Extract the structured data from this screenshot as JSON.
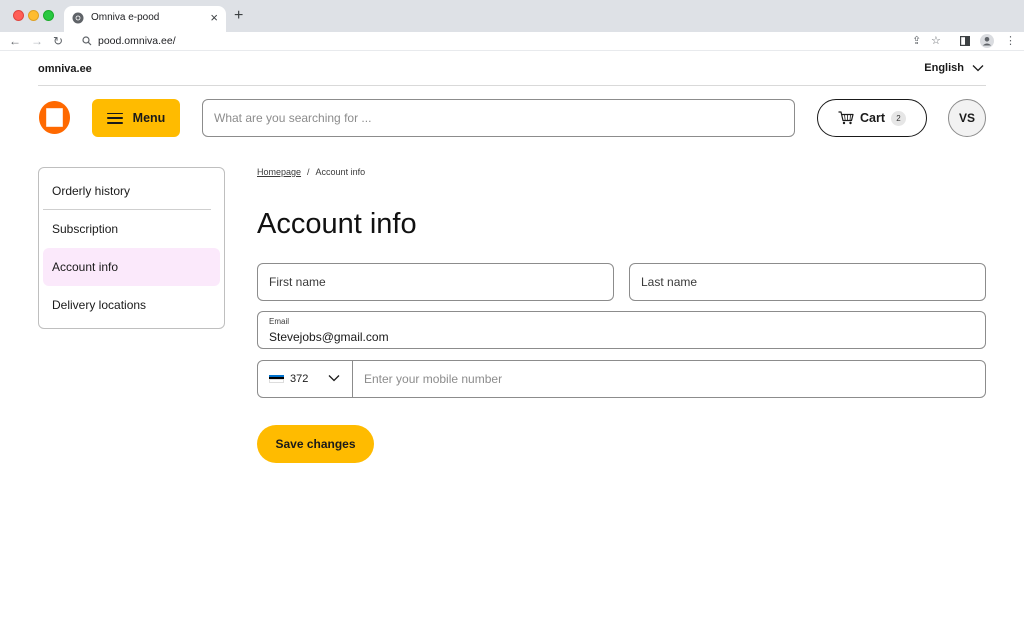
{
  "browser": {
    "tab_title": "Omniva e-pood",
    "tab_close": "×",
    "new_tab": "+",
    "url": "pood.omniva.ee/",
    "back": "←",
    "forward": "→",
    "reload": "↻",
    "share": "⇪",
    "star": "☆",
    "menu": "⋮"
  },
  "site": {
    "top_link": "omniva.ee",
    "language": "English",
    "brand_color": "#ff6900",
    "accent_color": "#ffbb00"
  },
  "header": {
    "menu_label": "Menu",
    "search_placeholder": "What are you searching for ...",
    "cart_label": "Cart",
    "cart_count": "2",
    "avatar_initials": "VS"
  },
  "sidebar": {
    "items": [
      {
        "label": "Orderly history"
      },
      {
        "label": "Subscription"
      },
      {
        "label": "Account info"
      },
      {
        "label": "Delivery locations"
      }
    ]
  },
  "breadcrumb": {
    "home": "Homepage",
    "separator": "/",
    "current": "Account info"
  },
  "main": {
    "title": "Account info",
    "first_name_placeholder": "First name",
    "last_name_placeholder": "Last name",
    "email_label": "Email",
    "email_value": "Stevejobs@gmail.com",
    "country_code": "372",
    "phone_placeholder": "Enter your mobile number",
    "save_label": "Save changes"
  }
}
